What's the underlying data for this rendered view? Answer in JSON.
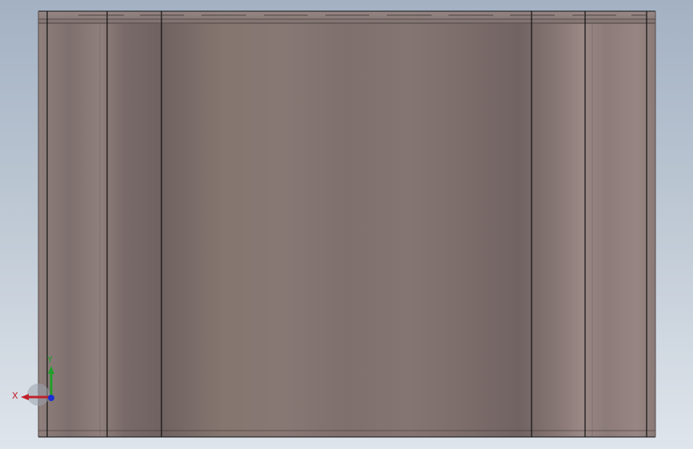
{
  "viewport": {
    "background_top": "#a3b1c3",
    "background_bottom": "#dfe5ec"
  },
  "model": {
    "color_base": "#7f7270",
    "edge_color": "#111111"
  },
  "triad": {
    "x_label": "X",
    "y_label": "Y",
    "x_color": "#c0202a",
    "y_color": "#1fa02a",
    "z_color": "#1a2fd0"
  }
}
